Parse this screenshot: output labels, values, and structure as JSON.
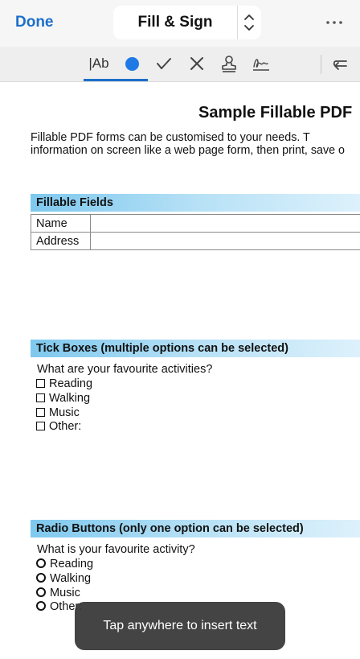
{
  "nav": {
    "done_label": "Done",
    "mode_label": "Fill & Sign"
  },
  "toolbar": {
    "text_tool_label": "|Ab",
    "accent_color": "#1c6fc9",
    "tools": [
      "text-icon",
      "dot-icon",
      "checkmark-icon",
      "cross-icon",
      "stamp-icon",
      "signature-icon",
      "undo-icon"
    ]
  },
  "document": {
    "title": "Sample Fillable PDF",
    "intro_line1": "Fillable PDF forms can be customised to your needs. T",
    "intro_line2": "information on screen like a web page form, then print, save o",
    "fillable": {
      "heading": "Fillable Fields",
      "rows": [
        {
          "label": "Name",
          "value": ""
        },
        {
          "label": "Address",
          "value": ""
        }
      ]
    },
    "tick": {
      "heading": "Tick Boxes (multiple options can be selected)",
      "question": "What are your favourite activities?",
      "options": [
        "Reading",
        "Walking",
        "Music",
        "Other:"
      ]
    },
    "radio": {
      "heading": "Radio Buttons (only one option can be selected)",
      "question": "What is your favourite activity?",
      "options": [
        "Reading",
        "Walking",
        "Music",
        "Other:"
      ]
    }
  },
  "toast": {
    "message": "Tap anywhere to insert text"
  }
}
